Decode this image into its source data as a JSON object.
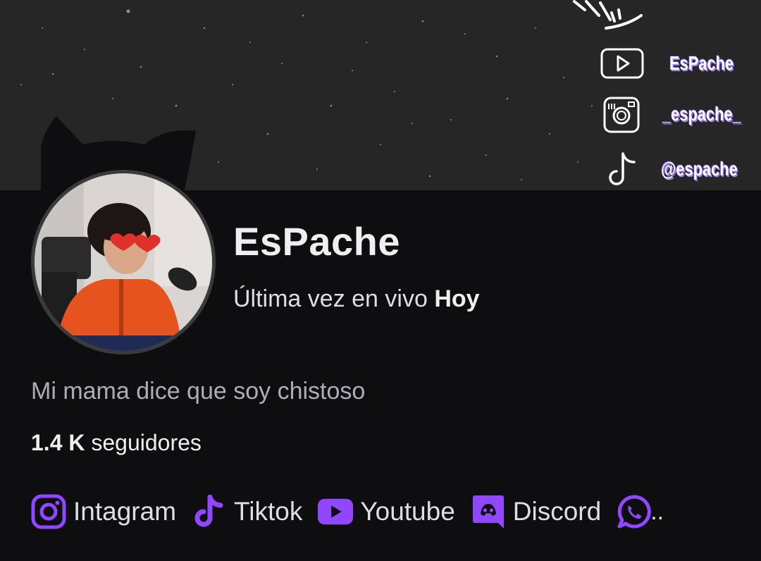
{
  "banner": {
    "socials": [
      {
        "icon": "youtube-outline-icon",
        "label": "EsPache"
      },
      {
        "icon": "instagram-outline-icon",
        "label": "_espache_"
      },
      {
        "icon": "tiktok-outline-icon",
        "label": "@espache"
      }
    ]
  },
  "profile": {
    "channel_name": "EsPache",
    "last_live_prefix": "Última vez en vivo",
    "last_live_value": "Hoy",
    "bio": "Mi mama dice que soy chistoso",
    "followers_count": "1.4 K",
    "followers_label": "seguidores"
  },
  "links": [
    {
      "icon": "instagram-icon",
      "label": "Intagram"
    },
    {
      "icon": "tiktok-icon",
      "label": "Tiktok"
    },
    {
      "icon": "youtube-icon",
      "label": "Youtube"
    },
    {
      "icon": "discord-icon",
      "label": "Discord"
    },
    {
      "icon": "whatsapp-icon",
      "label": ".."
    }
  ],
  "colors": {
    "accent": "#9147ff",
    "background": "#0e0e10",
    "banner": "#262626"
  }
}
